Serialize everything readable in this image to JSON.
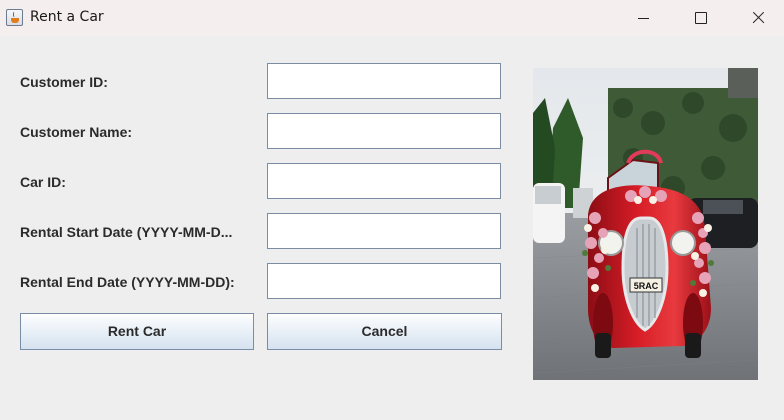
{
  "window": {
    "title": "Rent a Car",
    "icon": "java-cup-icon"
  },
  "form": {
    "fields": [
      {
        "label": "Customer ID:",
        "value": ""
      },
      {
        "label": "Customer Name:",
        "value": ""
      },
      {
        "label": "Car ID:",
        "value": ""
      },
      {
        "label": "Rental Start Date (YYYY-MM-D...",
        "value": ""
      },
      {
        "label": "Rental End Date (YYYY-MM-DD):",
        "value": ""
      }
    ],
    "rent_button": "Rent Car",
    "cancel_button": "Cancel"
  },
  "image": {
    "plate_text": "5RAC"
  },
  "colors": {
    "background": "#eeeeee",
    "titlebar": "#f5eeee",
    "field_border": "#7c8da3",
    "button_border": "#7b8da6",
    "car_red": "#c8161e"
  }
}
